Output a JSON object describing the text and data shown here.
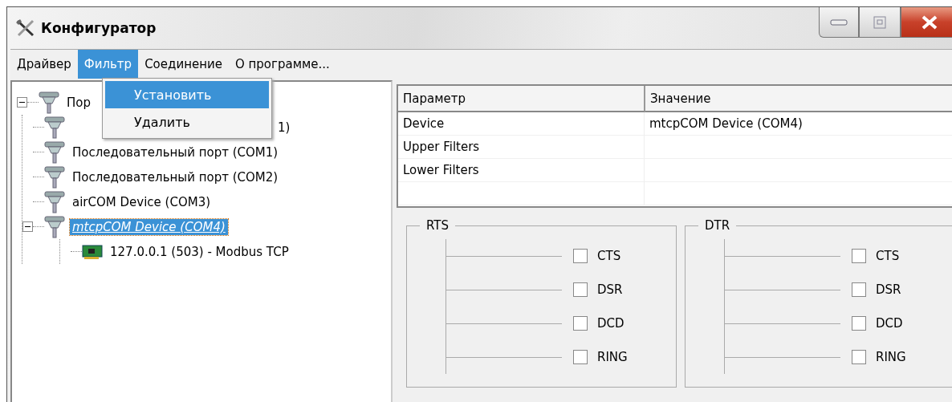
{
  "window": {
    "title": "Конфигуратор"
  },
  "menu": [
    {
      "label": "Драйвер",
      "selected": false
    },
    {
      "label": "Фильтр",
      "selected": true
    },
    {
      "label": "Соединение",
      "selected": false
    },
    {
      "label": "О программе...",
      "selected": false
    }
  ],
  "dropdown": [
    {
      "label": "Установить",
      "selected": true
    },
    {
      "label": "Удалить",
      "selected": false
    }
  ],
  "tree": [
    {
      "label": "Пор",
      "kind": "port",
      "selected": false,
      "expanded": true,
      "children": [
        {
          "label": "1)",
          "kind": "port",
          "selected": false,
          "covered": true
        },
        {
          "label": "Последовательный порт (COM1)",
          "kind": "port",
          "selected": false
        },
        {
          "label": "Последовательный порт (COM2)",
          "kind": "port",
          "selected": false
        },
        {
          "label": "airCOM Device (COM3)",
          "kind": "port",
          "selected": false
        },
        {
          "label": "mtcpCOM Device (COM4)",
          "kind": "port",
          "selected": true,
          "expanded": true,
          "children": [
            {
              "label": "127.0.0.1 (503) - Modbus TCP",
              "kind": "card",
              "selected": false
            }
          ]
        }
      ]
    }
  ],
  "table": {
    "columns": [
      "Параметр",
      "Значение"
    ],
    "rows": [
      [
        "Device",
        "mtcpCOM Device (COM4)"
      ],
      [
        "Upper Filters",
        ""
      ],
      [
        "Lower Filters",
        ""
      ]
    ]
  },
  "groups": [
    {
      "title": "RTS",
      "options": [
        {
          "label": "CTS",
          "checked": false
        },
        {
          "label": "DSR",
          "checked": false
        },
        {
          "label": "DCD",
          "checked": false
        },
        {
          "label": "RING",
          "checked": false
        }
      ]
    },
    {
      "title": "DTR",
      "options": [
        {
          "label": "CTS",
          "checked": false
        },
        {
          "label": "DSR",
          "checked": false
        },
        {
          "label": "DCD",
          "checked": false
        },
        {
          "label": "RING",
          "checked": false
        }
      ]
    }
  ]
}
